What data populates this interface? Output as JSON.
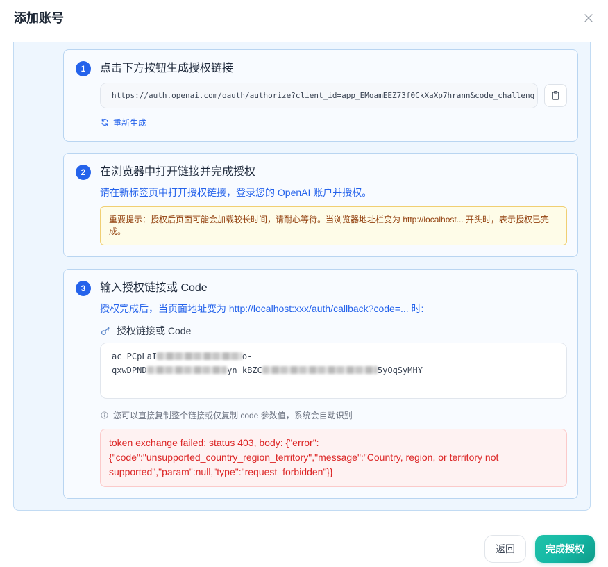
{
  "dialog": {
    "title": "添加账号",
    "close_icon": "close-icon"
  },
  "steps": [
    {
      "number": "1",
      "title": "点击下方按钮生成授权链接",
      "auth_url": "https://auth.openai.com/oauth/authorize?client_id=app_EMoamEEZ73f0CkXaXp7hrann&code_challeng",
      "copy_icon": "clipboard-icon",
      "regenerate_icon": "refresh-icon",
      "regenerate_label": "重新生成"
    },
    {
      "number": "2",
      "title": "在浏览器中打开链接并完成授权",
      "description": "请在新标签页中打开授权链接，登录您的 OpenAI 账户并授权。",
      "notice": "重要提示：授权后页面可能会加载较长时间，请耐心等待。当浏览器地址栏变为 http://localhost... 开头时，表示授权已完成。"
    },
    {
      "number": "3",
      "title": "输入授权链接或 Code",
      "description": "授权完成后，当页面地址变为 http://localhost:xxx/auth/callback?code=... 时:",
      "field_icon": "key-icon",
      "field_label": "授权链接或 Code",
      "code_value": {
        "line1": [
          "ac_PCpLaI",
          "o-"
        ],
        "line2": [
          "qxwDPND",
          "yn_kBZC",
          "5yOqSyMHY"
        ]
      },
      "hint_icon": "info-icon",
      "hint": "您可以直接复制整个链接或仅复制 code 参数值，系统会自动识别",
      "error": "token exchange failed: status 403, body: {\"error\":{\"code\":\"unsupported_country_region_territory\",\"message\":\"Country, region, or territory not supported\",\"param\":null,\"type\":\"request_forbidden\"}}"
    }
  ],
  "footer": {
    "back_label": "返回",
    "submit_label": "完成授权"
  },
  "colors": {
    "accent": "#2563eb",
    "submit": "#14b8a6",
    "error_text": "#dc2626",
    "notice_text": "#92400e"
  }
}
